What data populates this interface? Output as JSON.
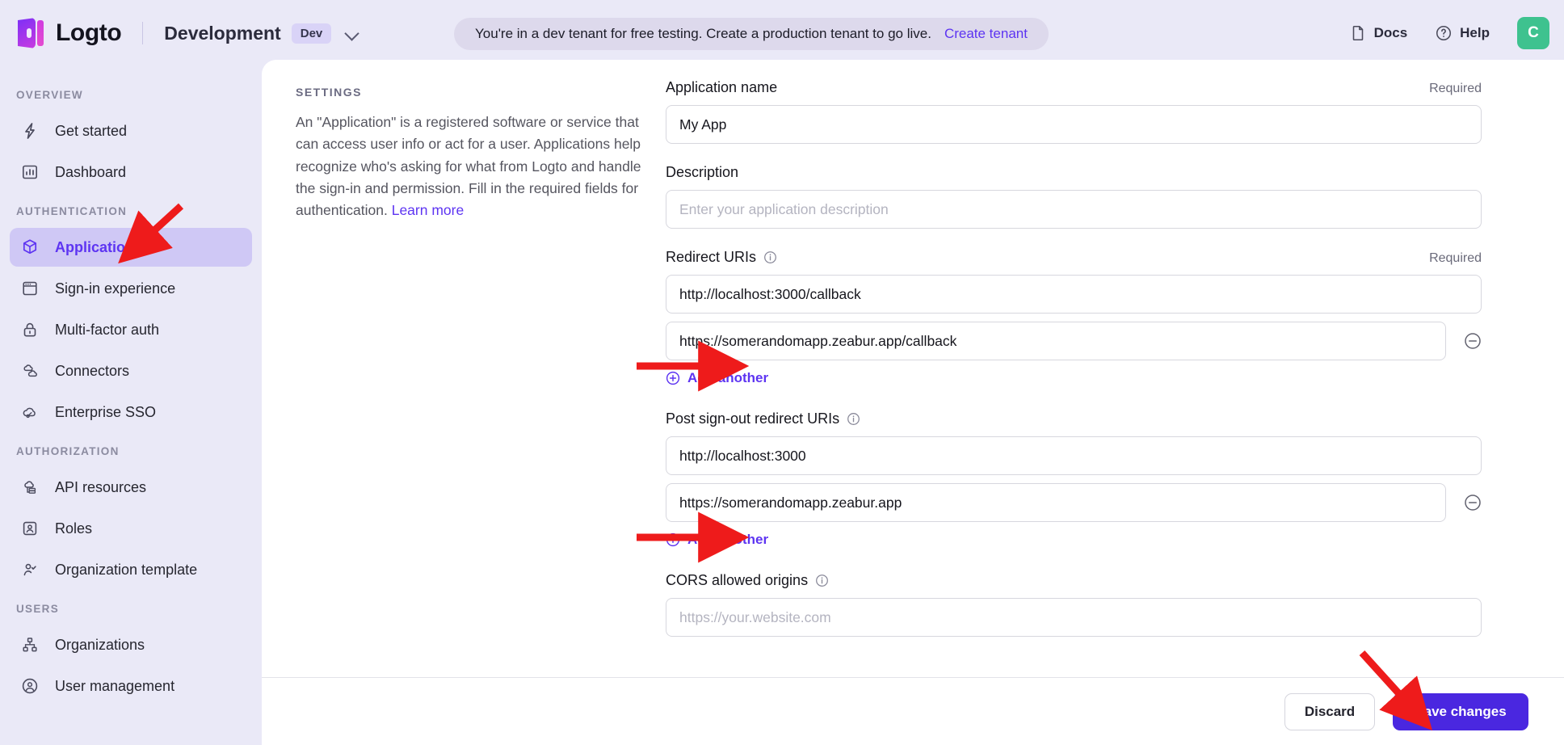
{
  "header": {
    "brand_name": "Logto",
    "logo_icon": "logto-logo-icon",
    "tenant_name": "Development",
    "tenant_badge": "Dev",
    "tenant_chevron_icon": "chevron-down-icon",
    "banner_text": "You're in a dev tenant for free testing. Create a production tenant to go live.",
    "banner_link": "Create tenant",
    "docs_label": "Docs",
    "docs_icon": "document-icon",
    "help_label": "Help",
    "help_icon": "question-circle-icon",
    "avatar_initial": "C",
    "avatar_color": "#3ec28f"
  },
  "sidebar": {
    "groups": [
      {
        "label": "Overview",
        "items": [
          {
            "label": "Get started",
            "icon": "lightning-bolt-icon",
            "active": false
          },
          {
            "label": "Dashboard",
            "icon": "bar-chart-icon",
            "active": false
          }
        ]
      },
      {
        "label": "Authentication",
        "items": [
          {
            "label": "Applications",
            "icon": "cube-icon",
            "active": true
          },
          {
            "label": "Sign-in experience",
            "icon": "browser-window-icon",
            "active": false
          },
          {
            "label": "Multi-factor auth",
            "icon": "lock-icon",
            "active": false
          },
          {
            "label": "Connectors",
            "icon": "connectors-icon",
            "active": false
          },
          {
            "label": "Enterprise SSO",
            "icon": "cloud-key-icon",
            "active": false
          }
        ]
      },
      {
        "label": "Authorization",
        "items": [
          {
            "label": "API resources",
            "icon": "api-resource-icon",
            "active": false
          },
          {
            "label": "Roles",
            "icon": "role-badge-icon",
            "active": false
          },
          {
            "label": "Organization template",
            "icon": "user-check-icon",
            "active": false
          }
        ]
      },
      {
        "label": "Users",
        "items": [
          {
            "label": "Organizations",
            "icon": "org-hierarchy-icon",
            "active": false
          },
          {
            "label": "User management",
            "icon": "user-circle-icon",
            "active": false
          }
        ]
      }
    ]
  },
  "settings_panel": {
    "kicker": "SETTINGS",
    "description": "An \"Application\" is a registered software or service that can access user info or act for a user. Applications help recognize who's asking for what from Logto and handle the sign-in and permission. Fill in the required fields for authentication.",
    "learn_more": "Learn more"
  },
  "form": {
    "application_name": {
      "label": "Application name",
      "required_text": "Required",
      "value": "My App"
    },
    "description": {
      "label": "Description",
      "placeholder": "Enter your application description",
      "value": ""
    },
    "redirect_uris": {
      "label": "Redirect URIs",
      "required_text": "Required",
      "info_icon": "info-circle-icon",
      "values": [
        "http://localhost:3000/callback",
        "https://somerandomapp.zeabur.app/callback"
      ],
      "remove_icon": "minus-circle-icon",
      "add_another": "Add another",
      "add_icon": "plus-circle-icon"
    },
    "post_signout_redirect_uris": {
      "label": "Post sign-out redirect URIs",
      "info_icon": "info-circle-icon",
      "values": [
        "http://localhost:3000",
        "https://somerandomapp.zeabur.app"
      ],
      "remove_icon": "minus-circle-icon",
      "add_another": "Add another",
      "add_icon": "plus-circle-icon"
    },
    "cors_allowed_origins": {
      "label": "CORS allowed origins",
      "info_icon": "info-circle-icon",
      "placeholder": "https://your.website.com",
      "value": ""
    }
  },
  "footer": {
    "discard_label": "Discard",
    "save_label": "Save changes",
    "save_color": "#4a27e0"
  },
  "annotations": {
    "color": "#ee1b1b",
    "arrows": [
      {
        "name": "arrow-to-applications"
      },
      {
        "name": "arrow-to-redirect-uri-2"
      },
      {
        "name": "arrow-to-post-signout-uri-2"
      },
      {
        "name": "arrow-to-save-changes"
      }
    ]
  }
}
